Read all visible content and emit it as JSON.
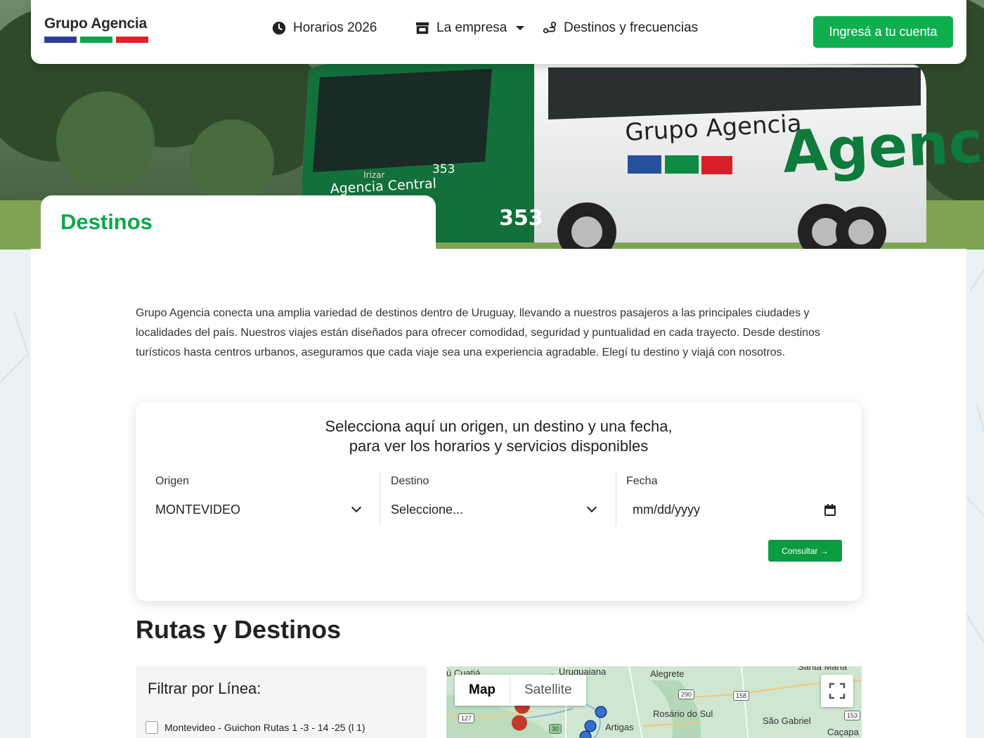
{
  "brand": {
    "name": "Grupo Agencia",
    "colors": {
      "blue": "#2d3e95",
      "green": "#0fa64b",
      "red": "#e3212c",
      "accent": "#0fae4f"
    }
  },
  "nav": {
    "items": [
      {
        "label": "Horarios 2026",
        "icon": "clock-icon"
      },
      {
        "label": "La empresa",
        "icon": "store-icon"
      },
      {
        "label": "Destinos y frecuencias",
        "icon": "route-icon"
      }
    ],
    "login_label": "Ingresá a tu cuenta"
  },
  "hero": {
    "title": "Destinos",
    "bus_text": {
      "side_small": "Grupo Agencia",
      "side_big": "Agencia",
      "front": "Agencia Central",
      "number": "353",
      "maker": "Irizar"
    }
  },
  "intro": "Grupo Agencia conecta una amplia variedad de destinos dentro de Uruguay, llevando a nuestros pasajeros a las principales ciudades y localidades del país. Nuestros viajes están diseñados para ofrecer comodidad, seguridad y puntualidad en cada trayecto. Desde destinos turísticos hasta centros urbanos, aseguramos que cada viaje sea una experiencia agradable. Elegí tu destino y viajá con nosotros.",
  "search": {
    "title_line1": "Selecciona aquí un origen, un destino y una fecha,",
    "title_line2": "para ver los horarios y servicios disponibles",
    "origin_label": "Origen",
    "origin_value": "MONTEVIDEO",
    "destination_label": "Destino",
    "destination_value": "Seleccione...",
    "date_label": "Fecha",
    "date_placeholder": "mm/dd/yyyy",
    "submit_label": "Consultar →"
  },
  "routes": {
    "title": "Rutas y Destinos",
    "filter_title": "Filtrar por Línea:",
    "filter_options": [
      "Montevideo - Guichon Rutas 1 -3 - 14 -25 (l 1)"
    ]
  },
  "map": {
    "type_map": "Map",
    "type_satellite": "Satellite",
    "places": [
      "Uruguaiana",
      "Alegrete",
      "Rosário do Sul",
      "São Gabriel",
      "Artigas",
      "Caçapa",
      "Santa Maria",
      "ú Cuatiá"
    ],
    "shields": [
      "290",
      "158",
      "153",
      "127",
      "30"
    ]
  }
}
